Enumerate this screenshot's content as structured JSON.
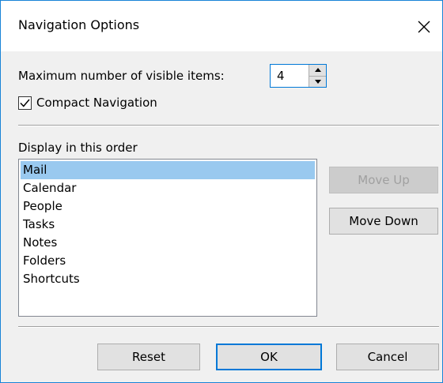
{
  "window": {
    "title": "Navigation Options"
  },
  "max_items": {
    "label": "Maximum number of visible items:",
    "value": "4"
  },
  "compact": {
    "label": "Compact Navigation",
    "checked": true
  },
  "order": {
    "label": "Display in this order",
    "items": [
      "Mail",
      "Calendar",
      "People",
      "Tasks",
      "Notes",
      "Folders",
      "Shortcuts"
    ],
    "selected": "Mail"
  },
  "buttons": {
    "move_up": "Move Up",
    "move_down": "Move Down",
    "reset": "Reset",
    "ok": "OK",
    "cancel": "Cancel"
  },
  "colors": {
    "accent": "#0078d7",
    "selection": "#99c9ef",
    "window_border": "#1883d7"
  }
}
